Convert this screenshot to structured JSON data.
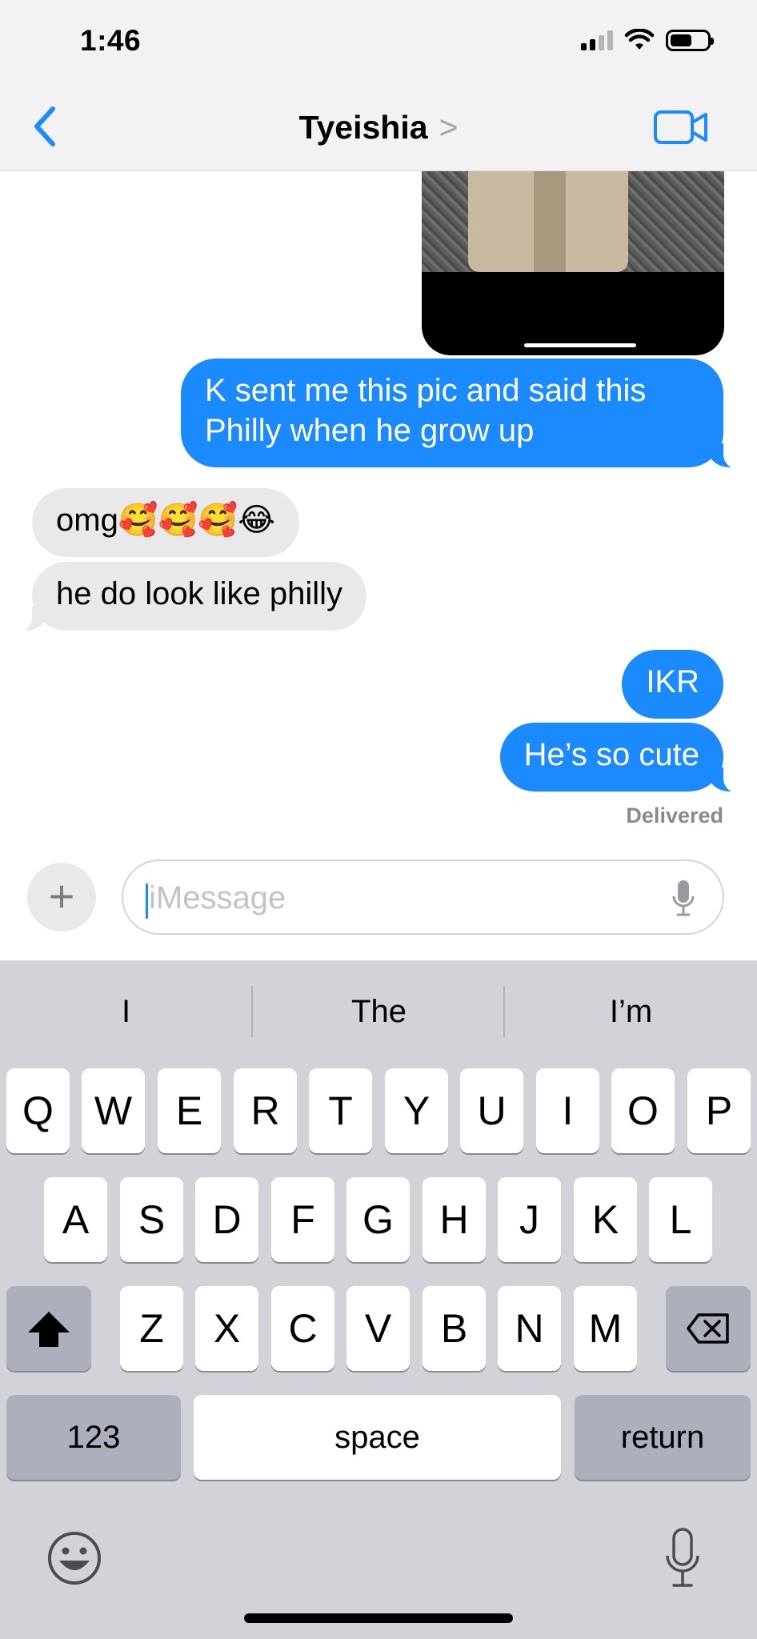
{
  "status_bar": {
    "time": "1:46",
    "battery_level": 0.58
  },
  "nav": {
    "contact_name": "Tyeishia",
    "chevron": ">"
  },
  "photo": {
    "emoji_strip": "😍😍😍"
  },
  "messages": [
    {
      "direction": "out",
      "text_lines": [
        "K sent me this pic and said this",
        "Philly when he grow up"
      ]
    },
    {
      "direction": "in",
      "text": "omg🥰🥰🥰😂"
    },
    {
      "direction": "in",
      "text": "he do look like philly"
    },
    {
      "direction": "out",
      "text": "IKR"
    },
    {
      "direction": "out",
      "text": "He’s so cute"
    }
  ],
  "status_label": "Delivered",
  "composer": {
    "plus": "+",
    "placeholder": "iMessage"
  },
  "keyboard": {
    "suggestions": [
      "I",
      "The",
      "I’m"
    ],
    "row1": [
      "Q",
      "W",
      "E",
      "R",
      "T",
      "Y",
      "U",
      "I",
      "O",
      "P"
    ],
    "row2": [
      "A",
      "S",
      "D",
      "F",
      "G",
      "H",
      "J",
      "K",
      "L"
    ],
    "row3": [
      "Z",
      "X",
      "C",
      "V",
      "B",
      "N",
      "M"
    ],
    "numbers_label": "123",
    "space_label": "space",
    "return_label": "return"
  },
  "colors": {
    "accent": "#1a8afe",
    "incoming_bubble": "#e9e9eb",
    "keyboard_bg": "#d1d3d9"
  }
}
